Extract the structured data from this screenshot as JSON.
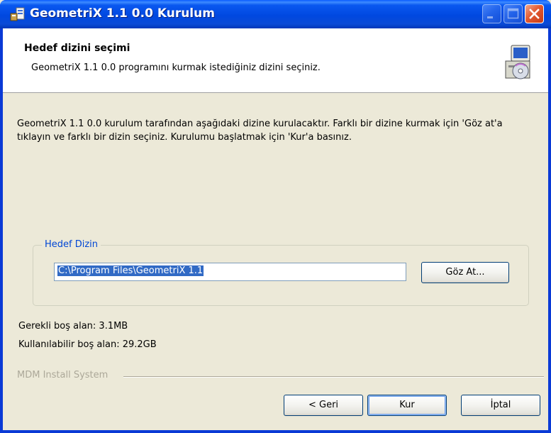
{
  "window": {
    "title": "GeometriX 1.1 0.0 Kurulum"
  },
  "header": {
    "title": "Hedef dizini seçimi",
    "subtitle": "GeometriX 1.1 0.0 programını kurmak istediğiniz dizini seçiniz."
  },
  "body": {
    "description": "GeometriX 1.1 0.0 kurulum tarafından aşağıdaki dizine kurulacaktır. Farklı bir dizine kurmak için 'Göz at'a tıklayın ve farklı bir dizin seçiniz. Kurulumu başlatmak için 'Kur'a basınız.",
    "group_label": "Hedef Dizin",
    "path_value": "C:\\Program Files\\GeometriX 1.1",
    "browse_label": "Göz At...",
    "space_required": "Gerekli boş alan: 3.1MB",
    "space_available": "Kullanılabilir boş alan: 29.2GB"
  },
  "footer": {
    "brand": "MDM Install System",
    "back_label": "< Geri",
    "install_label": "Kur",
    "cancel_label": "İptal"
  }
}
